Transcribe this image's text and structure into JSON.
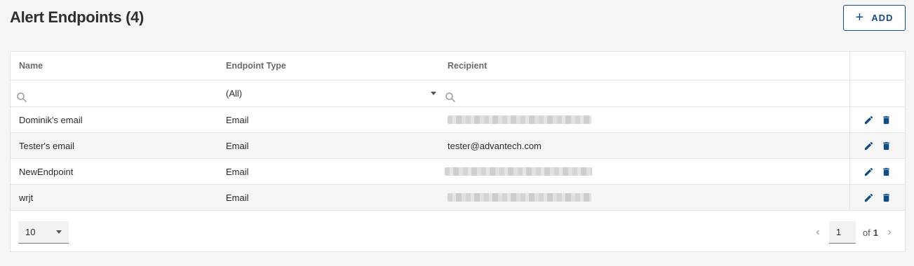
{
  "title": "Alert Endpoints (4)",
  "add_button": {
    "label": "ADD"
  },
  "columns": {
    "name": "Name",
    "type": "Endpoint Type",
    "recipient": "Recipient"
  },
  "filters": {
    "type_value": "(All)"
  },
  "rows": [
    {
      "name": "Dominik's email",
      "type": "Email",
      "recipient": "",
      "recipient_redacted": true
    },
    {
      "name": "Tester's email",
      "type": "Email",
      "recipient": "tester@advantech.com",
      "recipient_redacted": false
    },
    {
      "name": "NewEndpoint",
      "type": "Email",
      "recipient": "",
      "recipient_redacted": true
    },
    {
      "name": "wrjt",
      "type": "Email",
      "recipient": "",
      "recipient_redacted": true
    }
  ],
  "pagination": {
    "page_size": "10",
    "current_page": "1",
    "of_label": "of",
    "total_pages": "1"
  },
  "colors": {
    "primary": "#0f4c81",
    "row_alt": "#f5f5f5",
    "background": "#f5f5f6"
  },
  "icons": {
    "add": "plus-icon",
    "search": "search-icon",
    "edit": "pencil-icon",
    "delete": "trash-icon",
    "caret": "caret-down-icon",
    "prev": "chevron-left-icon",
    "next": "chevron-right-icon"
  }
}
